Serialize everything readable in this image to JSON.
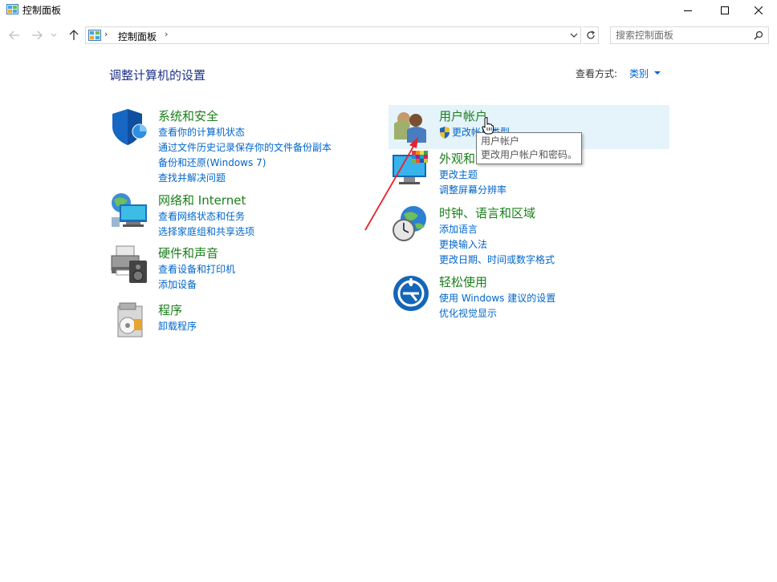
{
  "window": {
    "title": "控制面板",
    "minimize_icon": "minimize-icon",
    "maximize_icon": "maximize-icon",
    "close_icon": "close-icon"
  },
  "address": {
    "crumb": "控制面板",
    "search_placeholder": "搜索控制面板"
  },
  "header": {
    "title": "调整计算机的设置",
    "view_by_label": "查看方式:",
    "view_by_value": "类别"
  },
  "categories_left": [
    {
      "title": "系统和安全",
      "icon": "shield-icon",
      "links": [
        "查看你的计算机状态",
        "通过文件历史记录保存你的文件备份副本",
        "备份和还原(Windows 7)",
        "查找并解决问题"
      ]
    },
    {
      "title": "网络和 Internet",
      "icon": "network-globe-icon",
      "links": [
        "查看网络状态和任务",
        "选择家庭组和共享选项"
      ]
    },
    {
      "title": "硬件和声音",
      "icon": "printer-speaker-icon",
      "links": [
        "查看设备和打印机",
        "添加设备"
      ]
    },
    {
      "title": "程序",
      "icon": "programs-disc-icon",
      "links": [
        "卸载程序"
      ]
    }
  ],
  "categories_right": [
    {
      "title": "用户帐户",
      "icon": "users-icon",
      "links": [
        "更改帐户类型"
      ]
    },
    {
      "title": "外观和个性化",
      "icon": "appearance-monitor-icon",
      "links": [
        "更改主题",
        "调整屏幕分辨率"
      ]
    },
    {
      "title": "时钟、语言和区域",
      "icon": "clock-globe-icon",
      "links": [
        "添加语言",
        "更换输入法",
        "更改日期、时间或数字格式"
      ]
    },
    {
      "title": "轻松使用",
      "icon": "ease-of-access-icon",
      "links": [
        "使用 Windows 建议的设置",
        "优化视觉显示"
      ]
    }
  ],
  "tooltip": {
    "line1": "用户帐户",
    "line2": "更改用户帐户和密码。"
  },
  "colors": {
    "category_title": "#1a7f1a",
    "link": "#0066cc",
    "heading": "#1e3287",
    "hover_bg": "#e5f3fb",
    "annotation_arrow": "#e8202a"
  }
}
